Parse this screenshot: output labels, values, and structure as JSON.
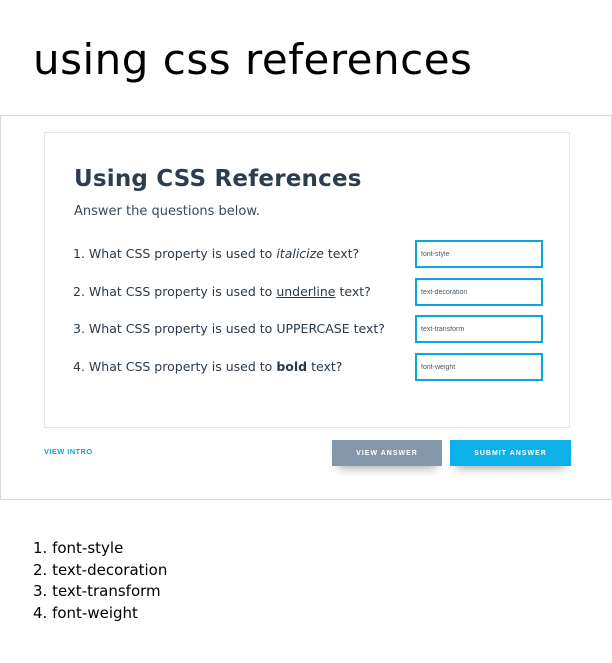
{
  "heading": "using css references",
  "card": {
    "title": "Using CSS References",
    "subtitle": "Answer the questions below."
  },
  "questions": [
    {
      "number": "1.",
      "before": "What CSS property is used to",
      "emphasis": "italicize",
      "emphasis_style": "italic",
      "after": "text?",
      "answer_value": "font-style"
    },
    {
      "number": "2.",
      "before": "What CSS property is used to",
      "emphasis": "underline",
      "emphasis_style": "underline",
      "after": "text?",
      "answer_value": "text-decoration"
    },
    {
      "number": "3.",
      "before": "What CSS property is used to",
      "emphasis": "UPPERCASE",
      "emphasis_style": "plain",
      "after": "text?",
      "answer_value": "text-transform"
    },
    {
      "number": "4.",
      "before": "What CSS property is used to",
      "emphasis": "bold",
      "emphasis_style": "bold",
      "after": "text?",
      "answer_value": "font-weight"
    }
  ],
  "footer": {
    "view_intro": "VIEW INTRO",
    "view_answer": "VIEW ANSWER",
    "submit_answer": "SUBMIT ANSWER"
  },
  "answers_key": [
    "1. font-style",
    "2. text-decoration",
    "3. text-transform",
    "4. font-weight"
  ],
  "colors": {
    "accent": "#0cb1e8",
    "input_border": "#0ea5d8",
    "secondary_button": "#8597ab",
    "title_text": "#2e3d4e"
  }
}
